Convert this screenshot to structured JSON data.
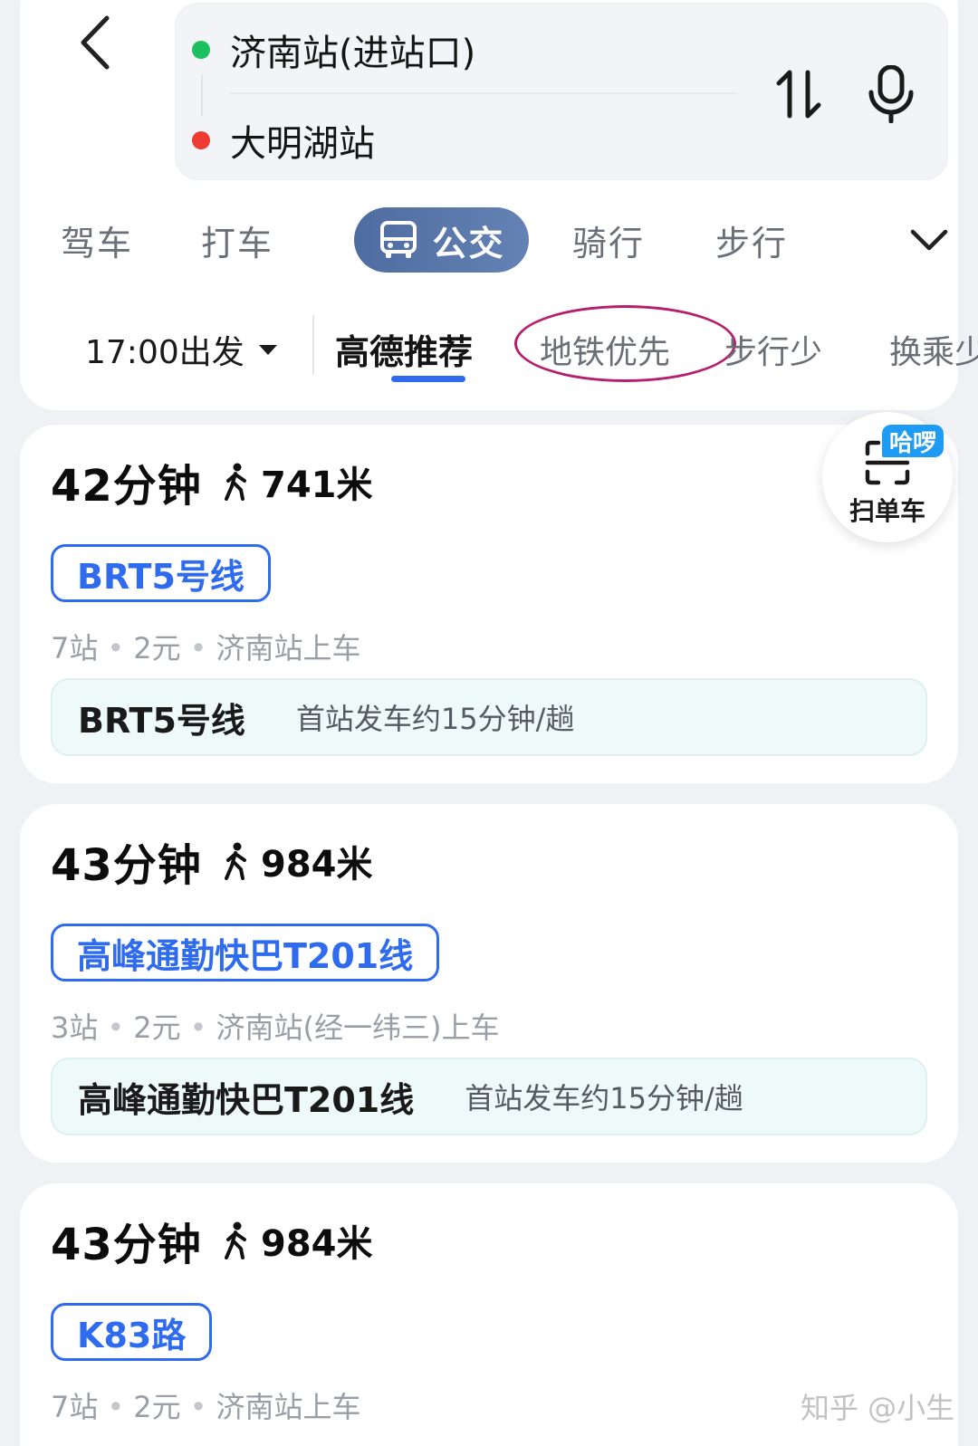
{
  "route": {
    "from": "济南站(进站口)",
    "to": "大明湖站"
  },
  "colors": {
    "accent": "#2f6bef",
    "origin_dot": "#1bc160",
    "destination_dot": "#ee3a31",
    "active_mode": "#5a78ab",
    "annotation_circle": "#b51f6d"
  },
  "modes": [
    {
      "label": "驾车"
    },
    {
      "label": "打车"
    },
    {
      "label": "公交",
      "icon": "bus-icon",
      "active": true
    },
    {
      "label": "骑行"
    },
    {
      "label": "步行"
    }
  ],
  "depart": "17:00出发",
  "filters": [
    {
      "label": "高德推荐",
      "active": true
    },
    {
      "label": "地铁优先"
    },
    {
      "label": "步行少"
    },
    {
      "label": "换乘少"
    }
  ],
  "scan_bike": {
    "badge": "哈啰",
    "label": "扫单车"
  },
  "results": [
    {
      "duration": "42分钟",
      "walk": "741米",
      "line": "BRT5号线",
      "stops": "7站",
      "fare": "2元",
      "board": "济南站上车",
      "freq_line": "BRT5号线",
      "freq": "首站发车约15分钟/趟"
    },
    {
      "duration": "43分钟",
      "walk": "984米",
      "line": "高峰通勤快巴T201线",
      "stops": "3站",
      "fare": "2元",
      "board": "济南站(经一纬三)上车",
      "freq_line": "高峰通勤快巴T201线",
      "freq": "首站发车约15分钟/趟"
    },
    {
      "duration": "43分钟",
      "walk": "984米",
      "line": "K83路",
      "stops": "7站",
      "fare": "2元",
      "board": "济南站上车"
    }
  ],
  "watermark": "知乎 @小生"
}
